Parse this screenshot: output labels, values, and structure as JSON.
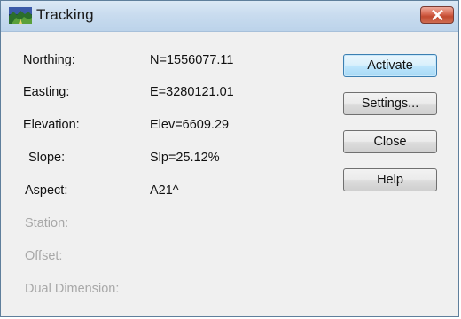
{
  "window": {
    "title": "Tracking"
  },
  "fields": [
    {
      "label": "Northing:",
      "value": "N=1556077.11",
      "enabled": true
    },
    {
      "label": "Easting:",
      "value": "E=3280121.01",
      "enabled": true
    },
    {
      "label": "Elevation:",
      "value": "Elev=6609.29",
      "enabled": true
    },
    {
      "label": "Slope:",
      "value": "Slp=25.12%",
      "enabled": true
    },
    {
      "label": "Aspect:",
      "value": "A21^",
      "enabled": true
    },
    {
      "label": "Station:",
      "value": "",
      "enabled": false
    },
    {
      "label": "Offset:",
      "value": "",
      "enabled": false
    },
    {
      "label": "Dual Dimension:",
      "value": "",
      "enabled": false
    }
  ],
  "buttons": {
    "activate": "Activate",
    "settings": "Settings...",
    "close": "Close",
    "help": "Help"
  },
  "colors": {
    "close_button": "#c9573d",
    "default_button_border": "#3c7fb1",
    "disabled_text": "#a8a8a8"
  }
}
